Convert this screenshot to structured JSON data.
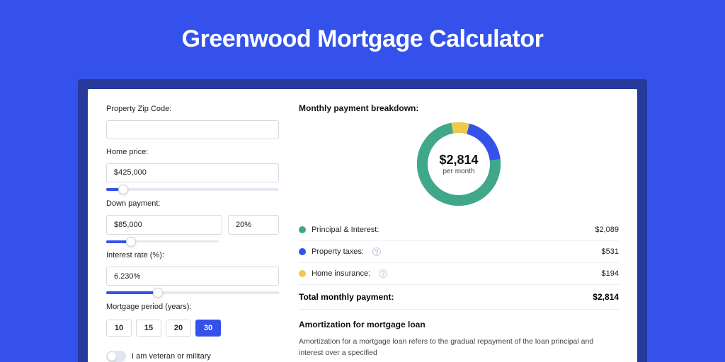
{
  "title": "Greenwood Mortgage Calculator",
  "colors": {
    "green": "#3fa78a",
    "blue": "#3452eb",
    "yellow": "#efc94c"
  },
  "form": {
    "zip": {
      "label": "Property Zip Code:",
      "value": ""
    },
    "home_price": {
      "label": "Home price:",
      "value": "$425,000",
      "slider_pct": 10
    },
    "down_payment": {
      "label": "Down payment:",
      "amount": "$85,000",
      "pct": "20%",
      "slider_pct": 22
    },
    "interest_rate": {
      "label": "Interest rate (%):",
      "value": "6.230%",
      "slider_pct": 30
    },
    "period": {
      "label": "Mortgage period (years):",
      "options": [
        "10",
        "15",
        "20",
        "30"
      ],
      "selected": "30"
    },
    "veteran": {
      "label": "I am veteran or military",
      "checked": false
    }
  },
  "breakdown": {
    "title": "Monthly payment breakdown:",
    "center_amount": "$2,814",
    "center_sub": "per month",
    "items": [
      {
        "label": "Principal & Interest:",
        "value": "$2,089",
        "color": "#3fa78a",
        "help": false,
        "share": 74
      },
      {
        "label": "Property taxes:",
        "value": "$531",
        "color": "#3452eb",
        "help": true,
        "share": 19
      },
      {
        "label": "Home insurance:",
        "value": "$194",
        "color": "#efc94c",
        "help": true,
        "share": 7
      }
    ],
    "total": {
      "label": "Total monthly payment:",
      "value": "$2,814"
    }
  },
  "amortization": {
    "title": "Amortization for mortgage loan",
    "text": "Amortization for a mortgage loan refers to the gradual repayment of the loan principal and interest over a specified"
  }
}
